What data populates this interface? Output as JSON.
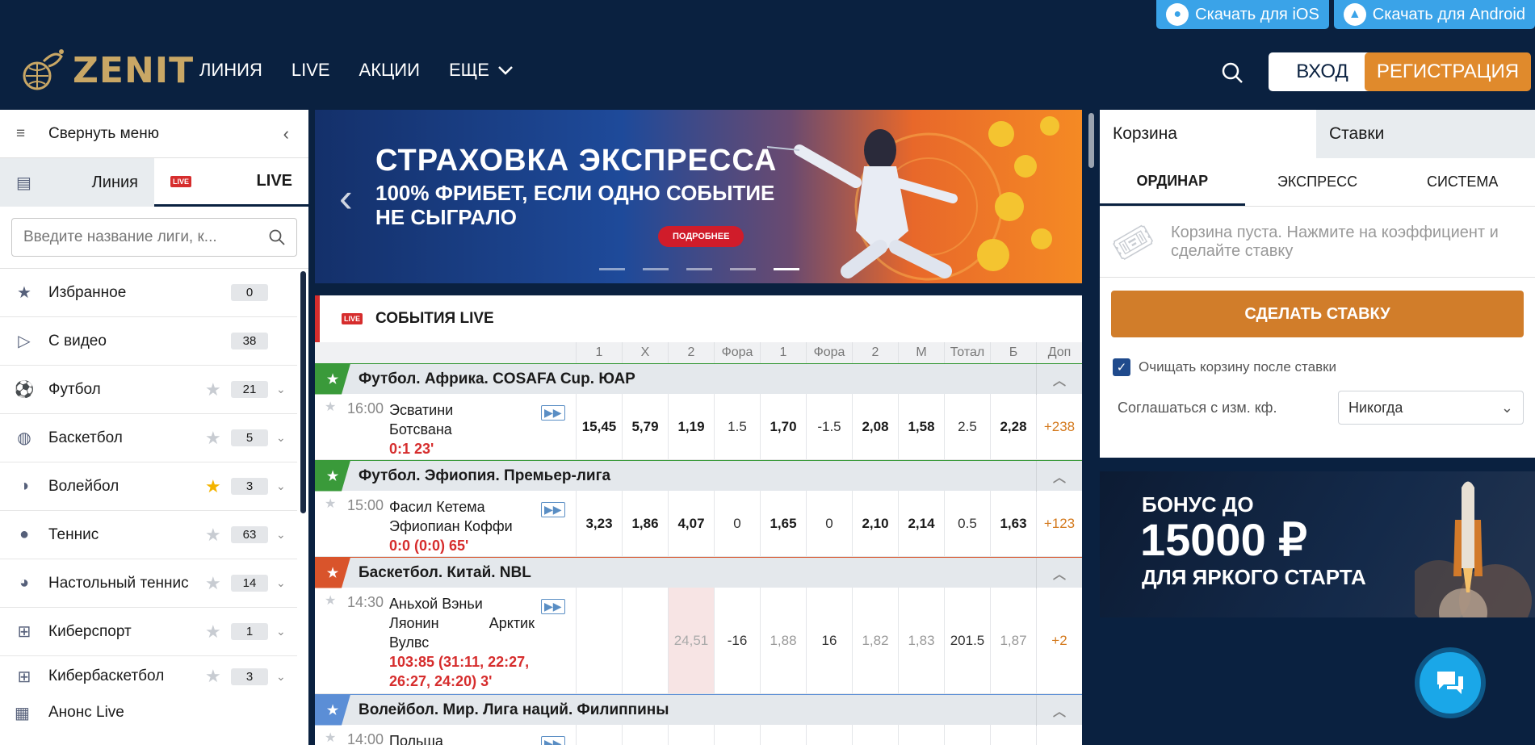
{
  "downloads": {
    "ios": "Скачать для iOS",
    "android": "Скачать для Android"
  },
  "header": {
    "logo": "ZENIT",
    "nav": [
      "ЛИНИЯ",
      "LIVE",
      "АКЦИИ",
      "ЕЩЕ"
    ],
    "login": "ВХОД",
    "register": "РЕГИСТРАЦИЯ"
  },
  "sidebar": {
    "collapse_label": "Свернуть меню",
    "tab_line": "Линия",
    "tab_live": "LIVE",
    "live_badge": "LIVE",
    "search_placeholder": "Введите название лиги, к...",
    "items": [
      {
        "name": "Избранное",
        "count": "0",
        "icon": "star-icon"
      },
      {
        "name": "С видео",
        "count": "38",
        "icon": "video-icon"
      },
      {
        "name": "Футбол",
        "count": "21",
        "icon": "football-icon"
      },
      {
        "name": "Баскетбол",
        "count": "5",
        "icon": "basketball-icon"
      },
      {
        "name": "Волейбол",
        "count": "3",
        "icon": "volleyball-icon",
        "fav": true
      },
      {
        "name": "Теннис",
        "count": "63",
        "icon": "tennis-icon"
      },
      {
        "name": "Настольный теннис",
        "count": "14",
        "icon": "table-tennis-icon"
      },
      {
        "name": "Киберспорт",
        "count": "1",
        "icon": "gamepad-icon"
      },
      {
        "name": "Кибербаскетбол",
        "count": "3",
        "icon": "gamepad-icon"
      }
    ],
    "announce": "Анонс Live"
  },
  "banner": {
    "title": "СТРАХОВКА ЭКСПРЕССА",
    "subtitle": "100% ФРИБЕТ, ЕСЛИ ОДНО СОБЫТИЕ НЕ СЫГРАЛО",
    "button": "ПОДРОБНЕЕ",
    "active_slide": 5,
    "slides": 5
  },
  "events": {
    "title": "СОБЫТИЯ LIVE",
    "live_badge": "LIVE",
    "columns": [
      "1",
      "X",
      "2",
      "Фора",
      "1",
      "Фора",
      "2",
      "М",
      "Тотал",
      "Б",
      "Доп"
    ],
    "leagues": [
      {
        "name": "Футбол. Африка. COSAFA Cup. ЮАР",
        "color": "#3a9a3a",
        "match": {
          "time": "16:00",
          "team1": "Эсватини",
          "team2": "Ботсвана",
          "score": "0:1 23'",
          "odds": [
            "15,45",
            "5,79",
            "1,19",
            "1.5",
            "1,70",
            "-1.5",
            "2,08",
            "1,58",
            "2.5",
            "2,28",
            "+238"
          ]
        }
      },
      {
        "name": "Футбол. Эфиопия. Премьер-лига",
        "color": "#3a9a3a",
        "match": {
          "time": "15:00",
          "team1": "Фасил Кетема",
          "team2": "Эфиопиан Коффи",
          "score": "0:0 (0:0) 65'",
          "odds": [
            "3,23",
            "1,86",
            "4,07",
            "0",
            "1,65",
            "0",
            "2,10",
            "2,14",
            "0.5",
            "1,63",
            "+123"
          ]
        }
      },
      {
        "name": "Баскетбол. Китай. NBL",
        "color": "#d9542b",
        "match": {
          "time": "14:30",
          "team1": "Аньхой Вэньи",
          "team2": "Ляонин",
          "team2b": "Арктик",
          "team3": "Вулвс",
          "score": "103:85 (31:11, 22:27,",
          "score2": "26:27, 24:20) 3'",
          "odds": [
            "",
            "",
            "24,51",
            "-16",
            "1,88",
            "16",
            "1,82",
            "1,83",
            "201.5",
            "1,87",
            "+2"
          ]
        }
      },
      {
        "name": "Волейбол. Мир. Лига наций. Филиппины",
        "color": "#5b8ed6",
        "match": {
          "time": "14:00",
          "team1": "Польша"
        }
      }
    ]
  },
  "slip": {
    "tab_basket": "Корзина",
    "tab_bets": "Ставки",
    "types": [
      "ОРДИНАР",
      "ЭКСПРЕСС",
      "СИСТЕМА"
    ],
    "empty_text": "Корзина пуста. Нажмите на коэффициент и сделайте ставку",
    "make_bet": "СДЕЛАТЬ СТАВКУ",
    "clear_label": "Очищать корзину после ставки",
    "agree_label": "Соглашаться с изм. кф.",
    "agree_value": "Никогда"
  },
  "promo": {
    "line1": "БОНУС ДО",
    "line2": "15000 ₽",
    "line3": "ДЛЯ ЯРКОГО СТАРТА"
  },
  "colors": {
    "navy": "#0a2140",
    "accent": "#e08a2c",
    "live": "#d62d2d",
    "info": "#3aa3e8"
  }
}
